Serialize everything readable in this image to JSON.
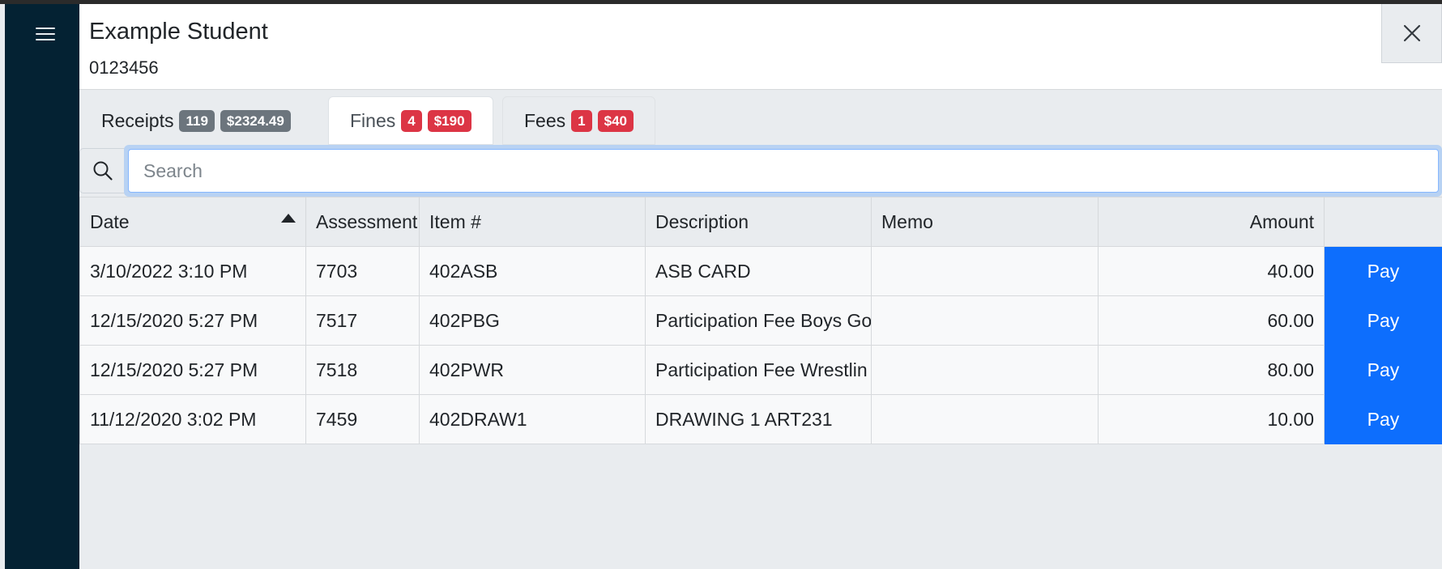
{
  "student": {
    "name": "Example Student",
    "id": "0123456"
  },
  "tabs": [
    {
      "label": "Receipts",
      "count": "119",
      "amount": "$2324.49"
    },
    {
      "label": "Fines",
      "count": "4",
      "amount": "$190"
    },
    {
      "label": "Fees",
      "count": "1",
      "amount": "$40"
    }
  ],
  "active_tab": "Fines",
  "search": {
    "placeholder": "Search",
    "value": ""
  },
  "table": {
    "columns": [
      "Date",
      "Assessment",
      "Item #",
      "Description",
      "Memo",
      "Amount",
      ""
    ],
    "sort": {
      "column": "Date",
      "direction": "ascending"
    },
    "rows": [
      {
        "date": "3/10/2022 3:10 PM",
        "assessment": "7703",
        "item": "402ASB",
        "description": "ASB CARD",
        "memo": "",
        "amount": "40.00",
        "action": "Pay"
      },
      {
        "date": "12/15/2020 5:27 PM",
        "assessment": "7517",
        "item": "402PBG",
        "description": "Participation Fee Boys Go",
        "memo": "",
        "amount": "60.00",
        "action": "Pay"
      },
      {
        "date": "12/15/2020 5:27 PM",
        "assessment": "7518",
        "item": "402PWR",
        "description": "Participation Fee Wrestlin",
        "memo": "",
        "amount": "80.00",
        "action": "Pay"
      },
      {
        "date": "11/12/2020 3:02 PM",
        "assessment": "7459",
        "item": "402DRAW1",
        "description": "DRAWING 1 ART231",
        "memo": "",
        "amount": "10.00",
        "action": "Pay"
      }
    ]
  },
  "icons": {
    "menu": "hamburger-icon",
    "close": "close-icon",
    "search": "search-icon",
    "sort": "sort-up-icon"
  },
  "colors": {
    "sidebar": "#042233",
    "primary": "#0d6efd",
    "danger": "#dc3545",
    "secondary": "#6c757d"
  }
}
